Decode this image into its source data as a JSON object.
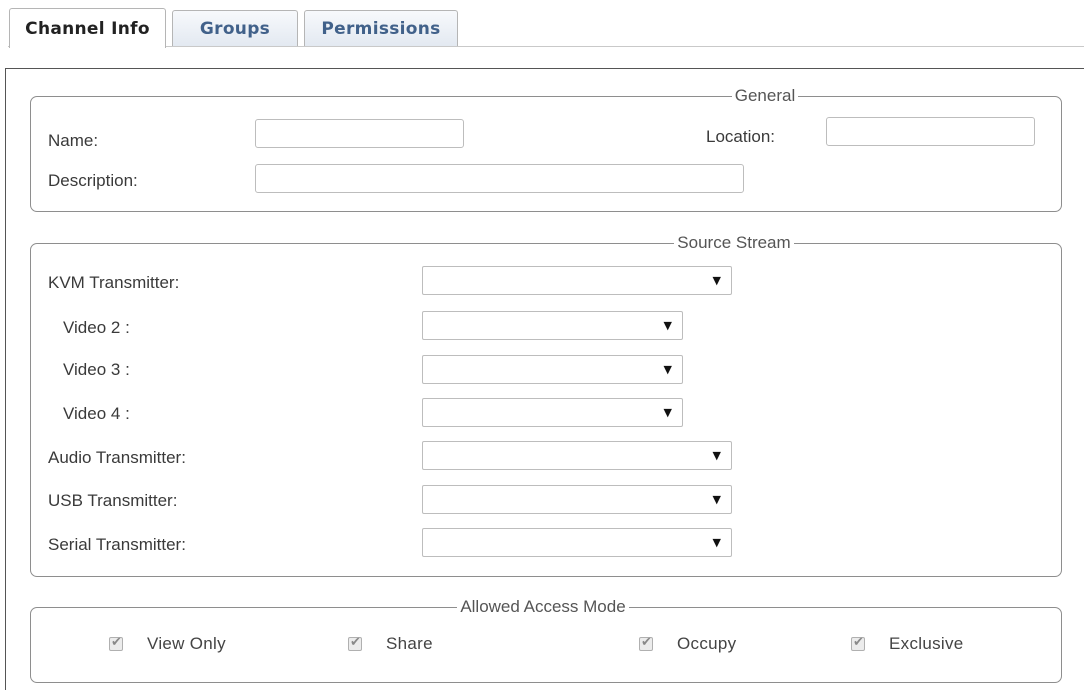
{
  "tabs": [
    {
      "label": "Channel Info",
      "active": true
    },
    {
      "label": "Groups",
      "active": false
    },
    {
      "label": "Permissions",
      "active": false
    }
  ],
  "general": {
    "title": "General",
    "name_label": "Name:",
    "name_value": "",
    "location_label": "Location:",
    "location_value": "",
    "description_label": "Description:",
    "description_value": ""
  },
  "source_stream": {
    "title": "Source Stream",
    "rows": [
      {
        "label": "KVM Transmitter:",
        "value": ""
      },
      {
        "label": "Video 2 :",
        "value": ""
      },
      {
        "label": "Video 3 :",
        "value": ""
      },
      {
        "label": "Video 4 :",
        "value": ""
      },
      {
        "label": "Audio Transmitter:",
        "value": ""
      },
      {
        "label": "USB Transmitter:",
        "value": ""
      },
      {
        "label": "Serial Transmitter:",
        "value": ""
      }
    ]
  },
  "access_mode": {
    "title": "Allowed Access Mode",
    "options": [
      {
        "label": "View Only",
        "checked": true
      },
      {
        "label": "Share",
        "checked": true
      },
      {
        "label": "Occupy",
        "checked": true
      },
      {
        "label": "Exclusive",
        "checked": true
      }
    ]
  },
  "icons": {
    "dropdown": "caret-down-icon",
    "checkbox": "checkmark-icon"
  }
}
